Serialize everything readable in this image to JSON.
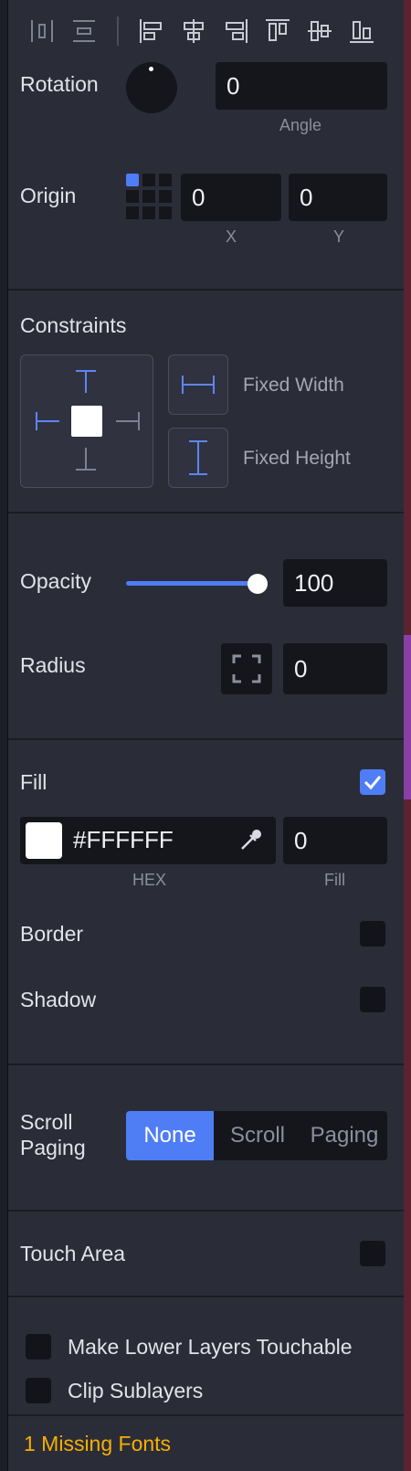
{
  "colors": {
    "accent": "#4f7df5",
    "warning": "#f5b000",
    "panel": "#2a2c38",
    "field": "#15161c"
  },
  "toolbar": {
    "icons": [
      "distribute-horizontal-icon",
      "distribute-vertical-icon",
      "align-left-icon",
      "align-center-horizontal-icon",
      "align-right-icon",
      "align-top-icon",
      "align-center-vertical-icon",
      "align-bottom-icon"
    ]
  },
  "rotation": {
    "label": "Rotation",
    "angle_value": "0",
    "angle_label": "Angle"
  },
  "origin": {
    "label": "Origin",
    "x_value": "0",
    "y_value": "0",
    "x_label": "X",
    "y_label": "Y"
  },
  "constraints": {
    "label": "Constraints",
    "fixed_width": "Fixed Width",
    "fixed_height": "Fixed Height"
  },
  "opacity": {
    "label": "Opacity",
    "value": "100",
    "level": 1.0
  },
  "radius": {
    "label": "Radius",
    "value": "0"
  },
  "fill": {
    "label": "Fill",
    "enabled": true,
    "hex_value": "#FFFFFF",
    "hex_label": "HEX",
    "fill_value": "0",
    "fill_label": "Fill",
    "swatch": "#ffffff"
  },
  "border": {
    "label": "Border"
  },
  "shadow": {
    "label": "Shadow"
  },
  "scroll_paging": {
    "label_line1": "Scroll",
    "label_line2": "Paging",
    "options": [
      "None",
      "Scroll",
      "Paging"
    ],
    "selected": "None"
  },
  "touch_area": {
    "label": "Touch Area"
  },
  "layers": {
    "make_touchable": "Make Lower Layers Touchable",
    "clip_sublayers": "Clip Sublayers"
  },
  "footer": {
    "missing_fonts": "1 Missing Fonts"
  }
}
